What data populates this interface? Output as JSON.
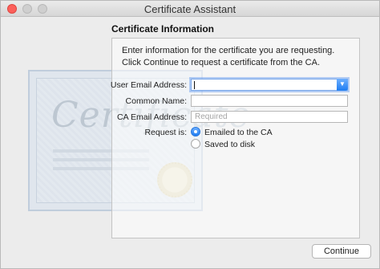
{
  "window": {
    "title": "Certificate Assistant"
  },
  "section": {
    "heading": "Certificate Information",
    "intro": "Enter information for the certificate you are requesting. Click Continue to request a certificate from the CA."
  },
  "form": {
    "user_email_label": "User Email Address:",
    "user_email_value": "",
    "common_name_label": "Common Name:",
    "common_name_value": "",
    "ca_email_label": "CA Email Address:",
    "ca_email_placeholder": "Required",
    "request_label": "Request is:",
    "options": [
      {
        "label": "Emailed to the CA",
        "selected": true
      },
      {
        "label": "Saved to disk",
        "selected": false
      }
    ]
  },
  "buttons": {
    "continue_label": "Continue"
  },
  "background_art": {
    "script_text": "Certificate"
  },
  "colors": {
    "accent": "#1d7cf2",
    "close": "#fc605b"
  }
}
